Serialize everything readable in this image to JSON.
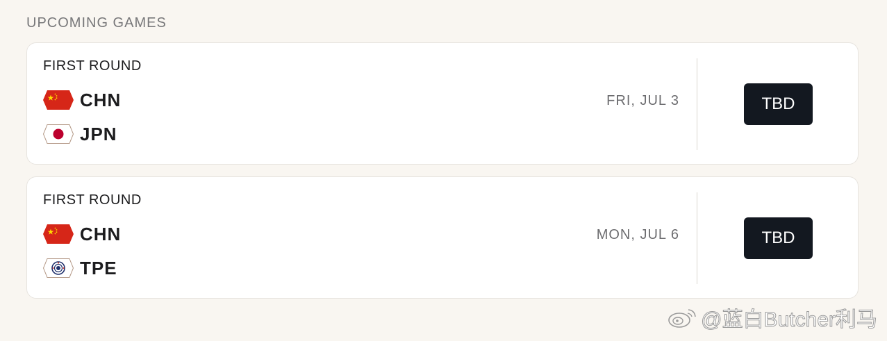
{
  "section": {
    "title": "UPCOMING GAMES"
  },
  "games": [
    {
      "round": "FIRST ROUND",
      "teams": [
        {
          "abbr": "CHN",
          "flag_icon": "china-flag-icon"
        },
        {
          "abbr": "JPN",
          "flag_icon": "japan-flag-icon"
        }
      ],
      "date": "FRI, JUL 3",
      "status_button": "TBD"
    },
    {
      "round": "FIRST ROUND",
      "teams": [
        {
          "abbr": "CHN",
          "flag_icon": "china-flag-icon"
        },
        {
          "abbr": "TPE",
          "flag_icon": "chinese-taipei-flag-icon"
        }
      ],
      "date": "MON, JUL 6",
      "status_button": "TBD"
    }
  ],
  "watermark": {
    "text": "@蓝白Butcher利马",
    "icon": "weibo-icon"
  },
  "colors": {
    "background": "#f9f6f1",
    "card": "#ffffff",
    "button": "#131820",
    "china_red": "#d62618",
    "china_star": "#ffde00",
    "japan_red": "#bc002d"
  }
}
